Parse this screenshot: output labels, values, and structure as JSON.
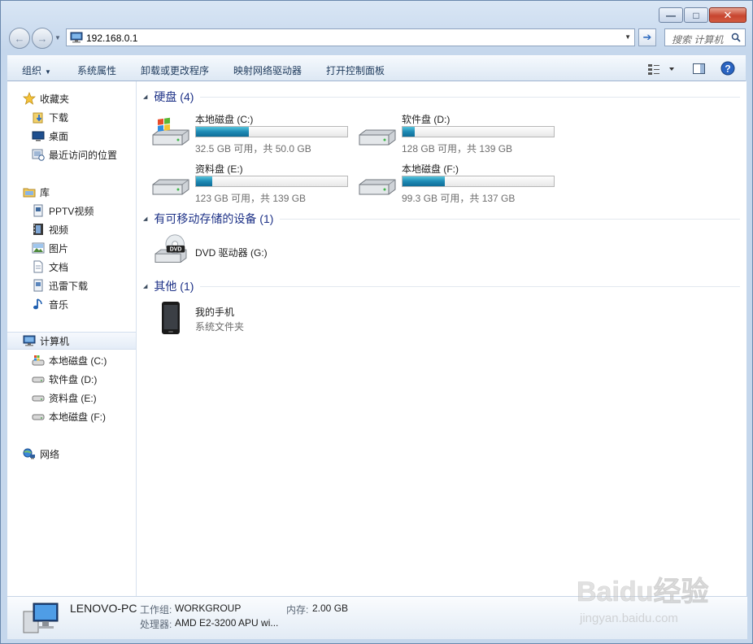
{
  "window": {
    "minimize_glyph": "—",
    "maximize_glyph": "□",
    "close_glyph": "✕"
  },
  "nav": {
    "back_glyph": "←",
    "forward_glyph": "→",
    "address": "192.168.0.1",
    "search_placeholder": "搜索 计算机"
  },
  "toolbar": {
    "organize": "组织",
    "system_properties": "系统属性",
    "uninstall": "卸载或更改程序",
    "map_drive": "映射网络驱动器",
    "control_panel": "打开控制面板"
  },
  "sidebar": {
    "favorites": {
      "label": "收藏夹",
      "items": [
        "下载",
        "桌面",
        "最近访问的位置"
      ]
    },
    "libraries": {
      "label": "库",
      "items": [
        "PPTV视频",
        "视频",
        "图片",
        "文档",
        "迅雷下载",
        "音乐"
      ]
    },
    "computer": {
      "label": "计算机",
      "items": [
        "本地磁盘 (C:)",
        "软件盘 (D:)",
        "资料盘 (E:)",
        "本地磁盘 (F:)"
      ]
    },
    "network": {
      "label": "网络"
    }
  },
  "content": {
    "hard_drives": {
      "title": "硬盘 (4)",
      "drives": [
        {
          "name": "本地磁盘 (C:)",
          "free": "32.5 GB 可用，共 50.0 GB",
          "used_fraction": 0.35
        },
        {
          "name": "软件盘 (D:)",
          "free": "128 GB 可用，共 139 GB",
          "used_fraction": 0.08
        },
        {
          "name": "资料盘 (E:)",
          "free": "123 GB 可用，共 139 GB",
          "used_fraction": 0.11
        },
        {
          "name": "本地磁盘 (F:)",
          "free": "99.3 GB 可用，共 137 GB",
          "used_fraction": 0.28
        }
      ]
    },
    "removable": {
      "title": "有可移动存储的设备 (1)",
      "dvd_name": "DVD 驱动器 (G:)",
      "dvd_label": "DVD"
    },
    "other": {
      "title": "其他 (1)",
      "phone_name": "我的手机",
      "phone_type": "系统文件夹"
    }
  },
  "details": {
    "computer_name": "LENOVO-PC",
    "workgroup_label": "工作组:",
    "workgroup_value": "WORKGROUP",
    "memory_label": "内存:",
    "memory_value": "2.00 GB",
    "processor_label": "处理器:",
    "processor_value": "AMD E2-3200 APU wi..."
  },
  "watermark": {
    "text": "Baidu经验",
    "url": "jingyan.baidu.com"
  }
}
